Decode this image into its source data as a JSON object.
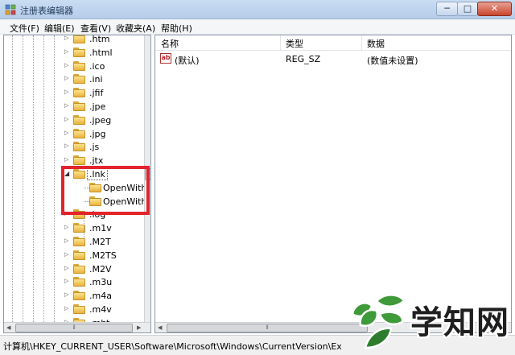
{
  "window": {
    "title": "注册表编辑器",
    "minimize": "─",
    "maximize": "□",
    "close": "✕"
  },
  "menu": [
    "文件(F)",
    "编辑(E)",
    "查看(V)",
    "收藏夹(A)",
    "帮助(H)"
  ],
  "tree": {
    "items": [
      {
        "label": ".htm",
        "expander": "▷"
      },
      {
        "label": ".html",
        "expander": "▷"
      },
      {
        "label": ".ico",
        "expander": "▷"
      },
      {
        "label": ".ini",
        "expander": "▷"
      },
      {
        "label": ".jfif",
        "expander": "▷"
      },
      {
        "label": ".jpe",
        "expander": "▷"
      },
      {
        "label": ".jpeg",
        "expander": "▷"
      },
      {
        "label": ".jpg",
        "expander": "▷"
      },
      {
        "label": ".js",
        "expander": "▷"
      },
      {
        "label": ".jtx",
        "expander": "▷"
      },
      {
        "label": ".lnk",
        "expander": "◢"
      },
      {
        "label": "OpenWith",
        "child": true
      },
      {
        "label": "OpenWith",
        "child": true
      },
      {
        "label": ".log",
        "expander": "▷"
      },
      {
        "label": ".m1v",
        "expander": "▷"
      },
      {
        "label": ".M2T",
        "expander": "▷"
      },
      {
        "label": ".M2TS",
        "expander": "▷"
      },
      {
        "label": ".M2V",
        "expander": "▷"
      },
      {
        "label": ".m3u",
        "expander": "▷"
      },
      {
        "label": ".m4a",
        "expander": "▷"
      },
      {
        "label": ".m4v",
        "expander": "▷"
      },
      {
        "label": ".mht",
        "expander": "▷"
      }
    ],
    "selected_label": ".lnk",
    "scroll_grip": "≡",
    "hscroll_left": "◀",
    "hscroll_right": "▶",
    "hscroll_grip": "⦀"
  },
  "list": {
    "columns": [
      "名称",
      "类型",
      "数据"
    ],
    "rows": [
      {
        "name": "(默认)",
        "type": "REG_SZ",
        "data": "(数值未设置)",
        "icon": "ab"
      }
    ],
    "hscroll_left": "◀",
    "hscroll_grip": "⦀"
  },
  "status": {
    "path": "计算机\\HKEY_CURRENT_USER\\Software\\Microsoft\\Windows\\CurrentVersion\\Explorer\\"
  },
  "watermark": {
    "text": "学知网"
  },
  "colors": {
    "highlight": "#e3232c",
    "logo_green": "#3f9a3a"
  }
}
